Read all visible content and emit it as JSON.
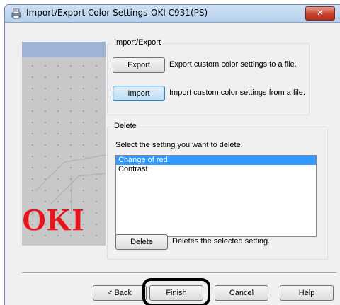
{
  "window": {
    "title": "Import/Export Color Settings-OKI C931(PS)",
    "close_label": "✕"
  },
  "brand": {
    "logo_text": "OKI",
    "accent": "#e8141b"
  },
  "import_export": {
    "group_label": "Import/Export",
    "export_button": "Export",
    "export_desc": "Export custom color settings to a file.",
    "import_button": "Import",
    "import_desc": "Import custom color settings from a file."
  },
  "delete_group": {
    "group_label": "Delete",
    "instruction": "Select the setting you want to delete.",
    "items": [
      "Change of red",
      "Contrast"
    ],
    "selected_index": 0,
    "delete_button": "Delete",
    "delete_desc": "Deletes the selected setting."
  },
  "footer": {
    "back_button": "< Back",
    "finish_button": "Finish",
    "cancel_button": "Cancel",
    "help_button": "Help"
  }
}
